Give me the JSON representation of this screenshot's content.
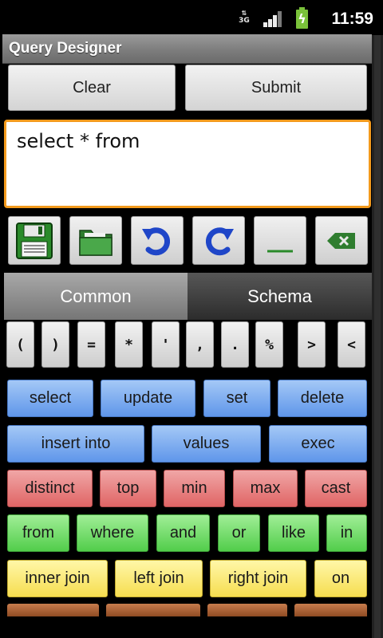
{
  "status_bar": {
    "network": "3G",
    "time": "11:59",
    "icons": [
      "network-3g-icon",
      "signal-icon",
      "battery-charging-icon"
    ]
  },
  "app": {
    "title": "Query Designer"
  },
  "actions": {
    "clear_label": "Clear",
    "submit_label": "Submit"
  },
  "query": {
    "text": "select * from"
  },
  "toolbar": {
    "icons": [
      "save-icon",
      "open-folder-icon",
      "undo-icon",
      "redo-icon",
      "space-icon",
      "backspace-icon"
    ]
  },
  "tabs": {
    "common": "Common",
    "schema": "Schema",
    "selected": "Common"
  },
  "symbols": [
    "(",
    ")",
    "=",
    "*",
    "'",
    ",",
    ".",
    "%",
    ">",
    "<"
  ],
  "keywords": {
    "blue1": [
      "select",
      "update",
      "set",
      "delete"
    ],
    "blue2": [
      "insert into",
      "values",
      "exec"
    ],
    "red": [
      "distinct",
      "top",
      "min",
      "max",
      "cast"
    ],
    "green": [
      "from",
      "where",
      "and",
      "or",
      "like",
      "in"
    ],
    "yellow": [
      "inner join",
      "left join",
      "right join",
      "on"
    ]
  },
  "colors": {
    "accent_focus": "#f39a1d",
    "blue_keys": "#5f96ea",
    "red_keys": "#e06565",
    "green_keys": "#52cd4b",
    "yellow_keys": "#f6dd50",
    "brown_keys": "#8f4b23"
  }
}
